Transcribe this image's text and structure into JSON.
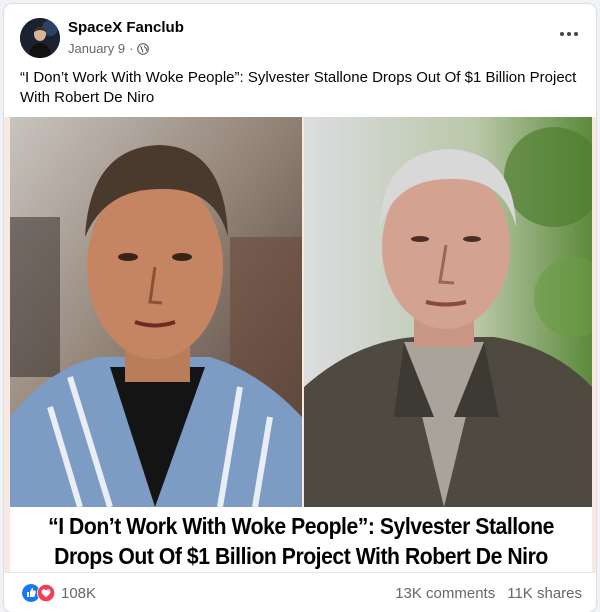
{
  "post": {
    "page_name": "SpaceX Fanclub",
    "date": "January 9",
    "separator": "·",
    "privacy_icon": "globe-icon",
    "more_icon": "more-options-icon",
    "caption": "“I Don’t Work With Woke People”: Sylvester Stallone Drops Out Of $1 Billion Project With Robert De Niro"
  },
  "media": {
    "headline_line1": "“I Don’t Work With Woke People”: Sylvester Stallone",
    "headline_line2": "Drops Out Of $1 Billion Project With Robert De Niro",
    "border_color": "#f5c9b8"
  },
  "engagement": {
    "reactions_count": "108K",
    "comments": "13K comments",
    "shares": "11K shares",
    "like_color": "#1877f2",
    "love_color": "#f33e58"
  }
}
